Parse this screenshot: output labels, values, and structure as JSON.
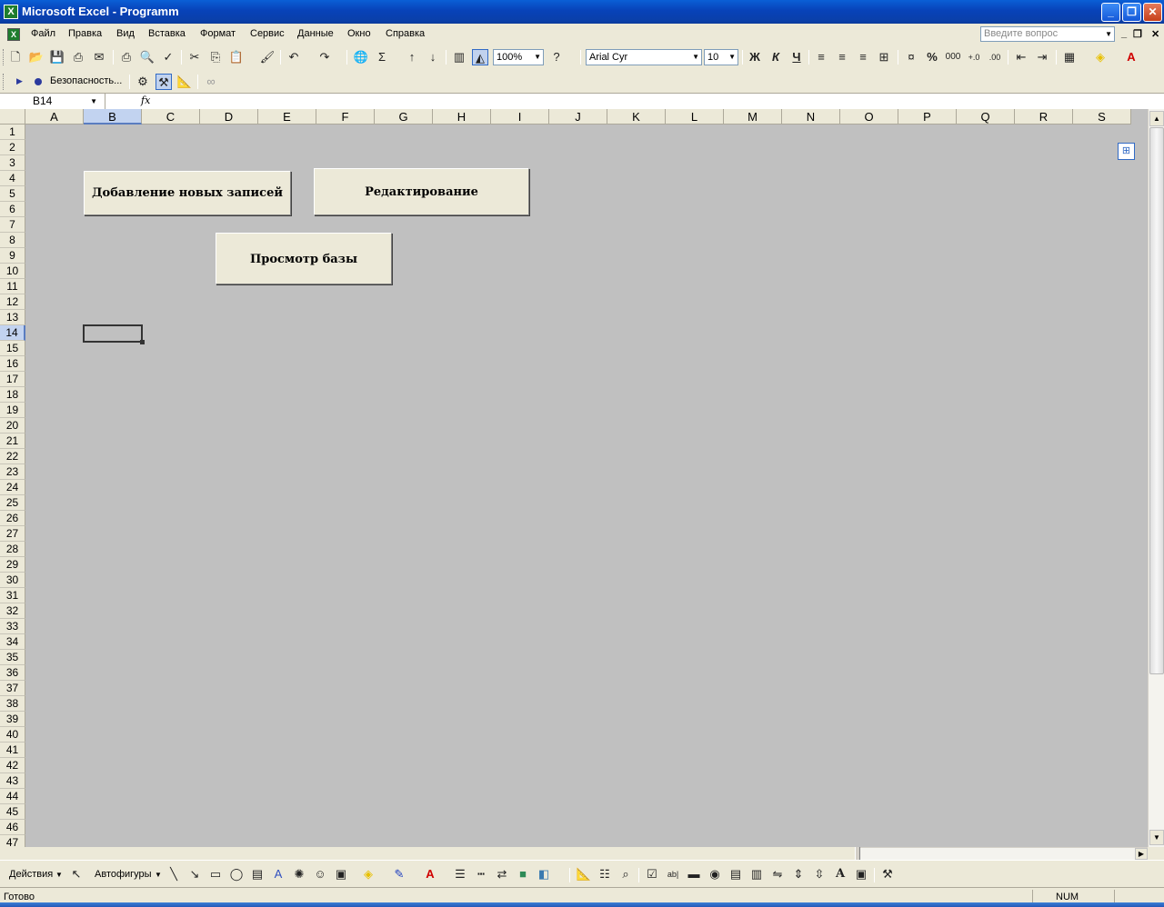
{
  "window": {
    "title": "Microsoft Excel - Programm",
    "app_icon": "X"
  },
  "menu": {
    "items": [
      "Файл",
      "Правка",
      "Вид",
      "Вставка",
      "Формат",
      "Сервис",
      "Данные",
      "Окно",
      "Справка"
    ],
    "help_placeholder": "Введите вопрос"
  },
  "toolbar": {
    "zoom": "100%",
    "font_name": "Arial Cyr",
    "font_size": "10",
    "bold_label": "Ж",
    "italic_label": "К",
    "underline_label": "Ч",
    "percent_label": "%",
    "thousands_label": "000"
  },
  "toolbar2": {
    "security_label": "Безопасность..."
  },
  "formula": {
    "name_box": "B14",
    "fx_label": "fx",
    "content": ""
  },
  "grid": {
    "columns": [
      "A",
      "B",
      "C",
      "D",
      "E",
      "F",
      "G",
      "H",
      "I",
      "J",
      "K",
      "L",
      "M",
      "N",
      "O",
      "P",
      "Q",
      "R",
      "S"
    ],
    "rows": [
      "1",
      "2",
      "3",
      "4",
      "5",
      "6",
      "7",
      "8",
      "9",
      "10",
      "11",
      "12",
      "13",
      "14",
      "15",
      "16",
      "17",
      "18",
      "19",
      "20",
      "21",
      "22",
      "23",
      "24",
      "25",
      "26",
      "27",
      "28",
      "29",
      "30",
      "31",
      "32",
      "33",
      "34",
      "35",
      "36",
      "37",
      "38",
      "39",
      "40",
      "41",
      "42",
      "43",
      "44",
      "45",
      "46",
      "47"
    ],
    "selected_column": "B",
    "selected_row": "14"
  },
  "buttons": {
    "add_records": "Добавление новых записей",
    "edit": "Редактирование",
    "view_db": "Просмотр базы"
  },
  "drawing": {
    "actions_label": "Действия",
    "autoshapes_label": "Автофигуры"
  },
  "status": {
    "text": "Готово",
    "num": "NUM"
  }
}
